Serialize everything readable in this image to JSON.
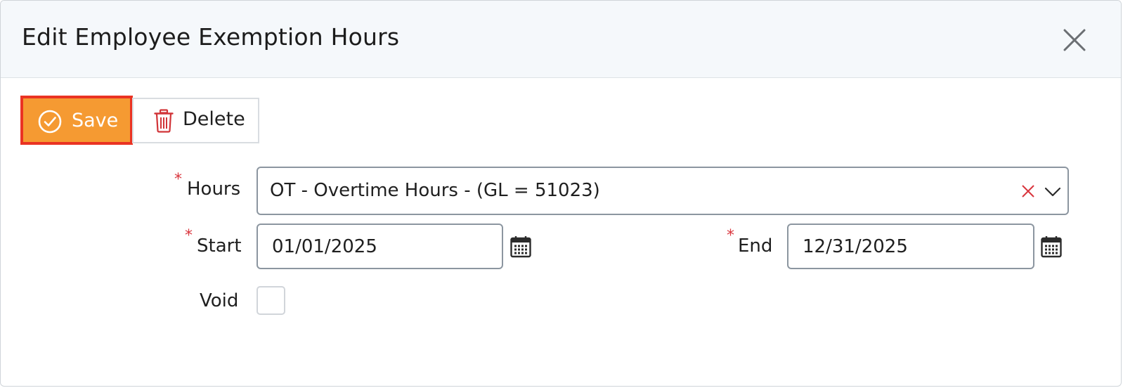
{
  "dialog": {
    "title": "Edit Employee Exemption Hours"
  },
  "toolbar": {
    "save_label": "Save",
    "delete_label": "Delete"
  },
  "form": {
    "hours": {
      "label": "Hours",
      "required_mark": "*",
      "value": "OT - Overtime Hours - (GL = 51023)"
    },
    "start": {
      "label": "Start",
      "required_mark": "*",
      "value": "01/01/2025"
    },
    "end": {
      "label": "End",
      "required_mark": "*",
      "value": "12/31/2025"
    },
    "void": {
      "label": "Void",
      "checked": false
    }
  },
  "colors": {
    "save_bg": "#f59a32",
    "highlight_border": "#ea3323",
    "required": "#d9363e",
    "delete_icon": "#d13438",
    "clear_icon": "#d9363e"
  },
  "icons": {
    "save": "check-circle-icon",
    "delete": "trash-icon",
    "close": "close-icon",
    "clear": "clear-x-icon",
    "dropdown": "chevron-down-icon",
    "date": "calendar-icon"
  }
}
